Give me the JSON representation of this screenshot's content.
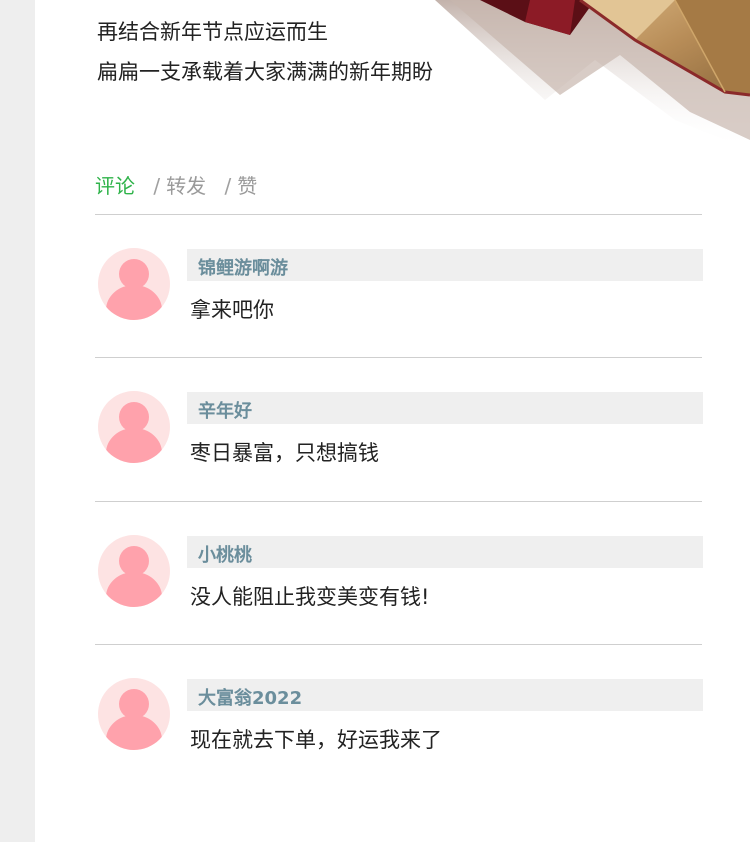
{
  "intro": {
    "lines": [
      "再结合新年节点应运而生",
      "扁扁一支承载着大家满满的新年期盼"
    ]
  },
  "tabs": [
    {
      "label": "评论",
      "active": true
    },
    {
      "label": "转发",
      "active": false
    },
    {
      "label": "赞",
      "active": false
    }
  ],
  "tab_separator": "/",
  "comments": [
    {
      "name": "锦鲤游啊游",
      "text": "拿来吧你"
    },
    {
      "name": "辛年好",
      "text": "枣日暴富，只想搞钱"
    },
    {
      "name": "小桃桃",
      "text": "没人能阻止我变美变有钱!"
    },
    {
      "name": "大富翁2022",
      "text": "现在就去下单，好运我来了"
    }
  ],
  "colors": {
    "active_tab": "#2fb34a",
    "inactive_tab": "#9a9a9a",
    "username": "#6b8e9c",
    "avatar_fill": "#ffa2ac",
    "avatar_bg": "#fde3e3",
    "name_bar_bg": "#efefef",
    "side_margin": "#eeeeee"
  },
  "icons": {
    "avatar": "default-user-avatar-icon"
  }
}
